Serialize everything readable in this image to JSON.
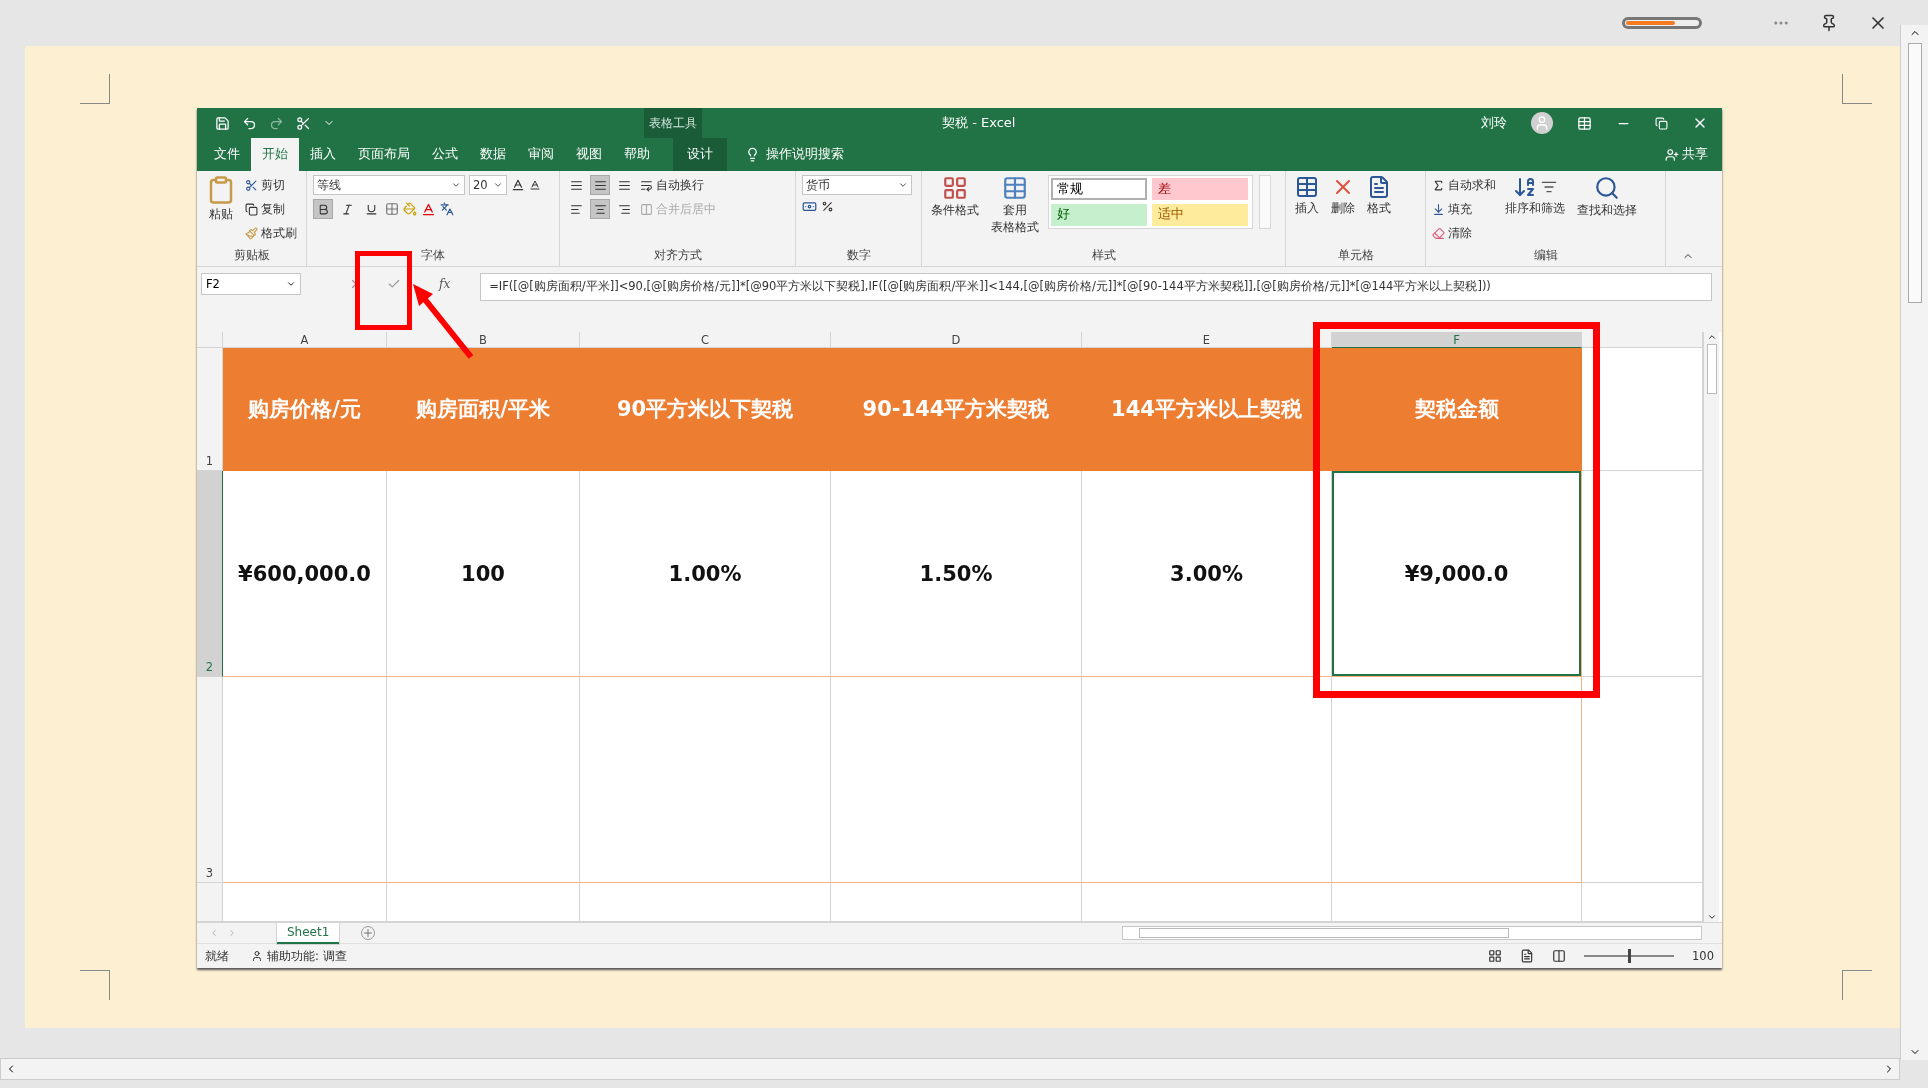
{
  "viewer": {
    "progress": {
      "level": 0.68
    }
  },
  "excel": {
    "context_tab": "表格工具",
    "title": "契税 - Excel",
    "user": "刘玲",
    "share": "共享",
    "tabs": [
      {
        "label": "文件",
        "selected": false,
        "kind": "file"
      },
      {
        "label": "开始",
        "selected": true,
        "kind": "normal"
      },
      {
        "label": "插入",
        "selected": false,
        "kind": "normal"
      },
      {
        "label": "页面布局",
        "selected": false,
        "kind": "normal"
      },
      {
        "label": "公式",
        "selected": false,
        "kind": "normal"
      },
      {
        "label": "数据",
        "selected": false,
        "kind": "normal"
      },
      {
        "label": "审阅",
        "selected": false,
        "kind": "normal"
      },
      {
        "label": "视图",
        "selected": false,
        "kind": "normal"
      },
      {
        "label": "帮助",
        "selected": false,
        "kind": "normal"
      },
      {
        "label": "设计",
        "selected": false,
        "kind": "context"
      }
    ],
    "tell_me": "操作说明搜索",
    "ribbon": {
      "clipboard": {
        "paste": "粘贴",
        "cut": "剪切",
        "copy": "复制",
        "format_painter": "格式刷",
        "label": "剪贴板"
      },
      "font": {
        "name": "等线",
        "size": "20",
        "bold": true,
        "italic": false,
        "underline": false,
        "label": "字体"
      },
      "alignment": {
        "valign": [
          {
            "selected": false
          },
          {
            "selected": true
          },
          {
            "selected": false
          }
        ],
        "halign": [
          {
            "selected": false
          },
          {
            "selected": true
          },
          {
            "selected": false
          }
        ],
        "wrap": "自动换行",
        "merge": {
          "label": "合并后居中",
          "disabled": true
        },
        "label": "对齐方式"
      },
      "number": {
        "format": "货币",
        "label": "数字"
      },
      "styles": {
        "conditional": "条件格式",
        "table_format": [
          "套用",
          "表格格式"
        ],
        "gallery": [
          {
            "label": "常规",
            "kind": "normal",
            "color": "#ffffff",
            "selected": true
          },
          {
            "label": "差",
            "kind": "bad",
            "color": "#ffc7ce",
            "selected": false
          },
          {
            "label": "好",
            "kind": "good",
            "color": "#c6efce",
            "selected": false
          },
          {
            "label": "适中",
            "kind": "neutral",
            "color": "#ffeb9c",
            "selected": false
          }
        ],
        "label": "样式"
      },
      "cells": {
        "insert": "插入",
        "delete": "删除",
        "format": "格式",
        "label": "单元格"
      },
      "editing": {
        "autosum": "自动求和",
        "fill": "填充",
        "clear": "清除",
        "sort": "排序和筛选",
        "find": "查找和选择",
        "label": "编辑"
      }
    },
    "formula_bar": {
      "name_box": "F2",
      "insert_function": "fx",
      "formula": "=IF([@[购房面积/平米]]<90,[@[购房价格/元]]*[@90平方米以下契税],IF([@[购房面积/平米]]<144,[@[购房价格/元]]*[@[90-144平方米契税]],[@[购房价格/元]]*[@144平方米以上契税]))"
    },
    "columns": [
      {
        "label": "A",
        "selected": false
      },
      {
        "label": "B",
        "selected": false
      },
      {
        "label": "C",
        "selected": false
      },
      {
        "label": "D",
        "selected": false
      },
      {
        "label": "E",
        "selected": false
      },
      {
        "label": "F",
        "selected": true
      }
    ],
    "rows": [
      {
        "header": "1",
        "selected": false,
        "kind": "header",
        "cells": [
          {
            "text": "购房价格/元",
            "selected": false
          },
          {
            "text": "购房面积/平米",
            "selected": false
          },
          {
            "text": "90平方米以下契税",
            "selected": false
          },
          {
            "text": "90-144平方米契税",
            "selected": false
          },
          {
            "text": "144平方米以上契税",
            "selected": false
          },
          {
            "text": "契税金额",
            "selected": false
          }
        ]
      },
      {
        "header": "2",
        "selected": true,
        "kind": "data",
        "cells": [
          {
            "text": "¥600,000.0",
            "selected": false
          },
          {
            "text": "100",
            "selected": false
          },
          {
            "text": "1.00%",
            "selected": false
          },
          {
            "text": "1.50%",
            "selected": false
          },
          {
            "text": "3.00%",
            "selected": false
          },
          {
            "text": "¥9,000.0",
            "selected": true
          }
        ]
      },
      {
        "header": "3",
        "selected": false,
        "kind": "data"
      }
    ],
    "sheet_tabs": [
      {
        "label": "Sheet1",
        "selected": true
      }
    ],
    "status": {
      "ready": "就绪",
      "accessibility": "辅助功能: 调查",
      "zoom": "100",
      "zoom_slider": {
        "level": 0.5
      }
    }
  }
}
